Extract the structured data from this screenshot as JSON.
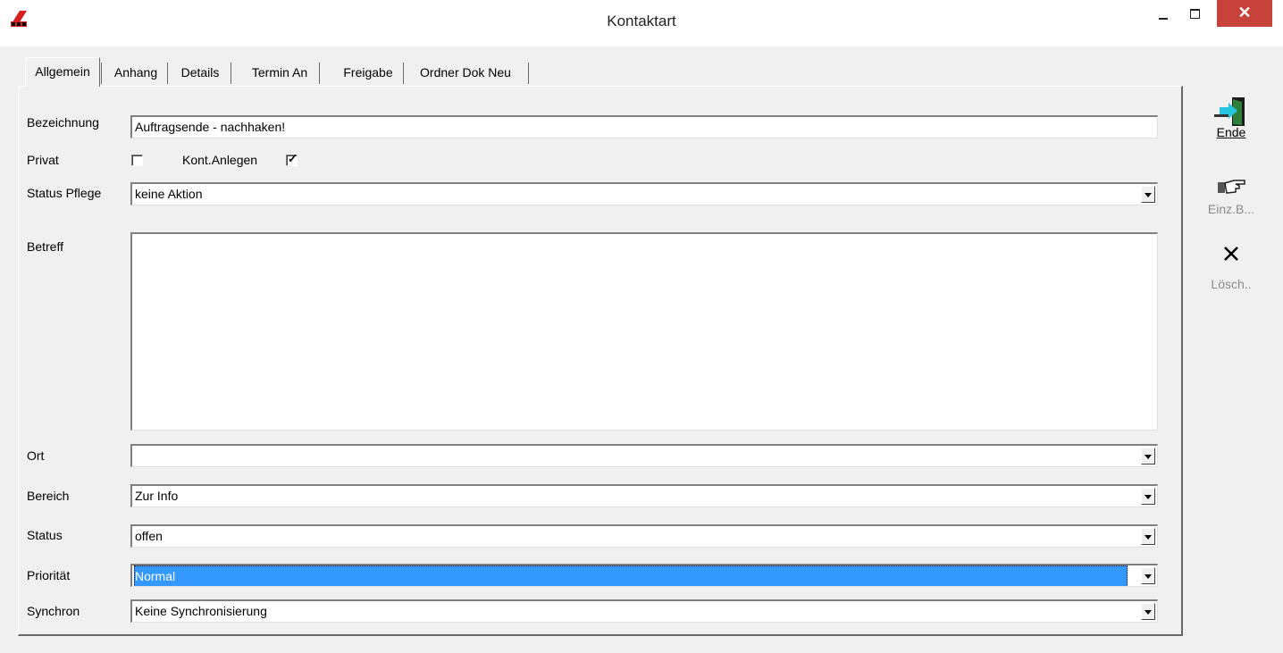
{
  "window": {
    "title": "Kontaktart",
    "close_label": "✕"
  },
  "tabs": [
    {
      "label": "Allgemein"
    },
    {
      "label": "Anhang"
    },
    {
      "label": "Details"
    },
    {
      "label": "Termin An"
    },
    {
      "label": "Freigabe"
    },
    {
      "label": "Ordner Dok Neu"
    }
  ],
  "form": {
    "bezeichnung": {
      "label": "Bezeichnung",
      "value": "Auftragsende - nachhaken!"
    },
    "privat": {
      "label": "Privat",
      "checked": false
    },
    "kont_anlegen": {
      "label": "Kont.Anlegen",
      "checked": true,
      "mark": "✓"
    },
    "status_pflege": {
      "label": "Status Pflege",
      "value": "keine Aktion"
    },
    "betreff": {
      "label": "Betreff",
      "value": ""
    },
    "ort": {
      "label": "Ort",
      "value": ""
    },
    "bereich": {
      "label": "Bereich",
      "value": "Zur Info"
    },
    "status": {
      "label": "Status",
      "value": "offen"
    },
    "prioritaet": {
      "label": "Priorität",
      "value": "Normal"
    },
    "synchron": {
      "label": "Synchron",
      "value": "Keine Synchronisierung"
    }
  },
  "toolbar": {
    "ende": {
      "label": "Ende",
      "icon": "exit-door-icon"
    },
    "einzb": {
      "label": "Einz.B...",
      "icon": "pointing-hand-icon"
    },
    "loesch": {
      "label": "Lösch..",
      "icon": "delete-x-icon"
    }
  }
}
